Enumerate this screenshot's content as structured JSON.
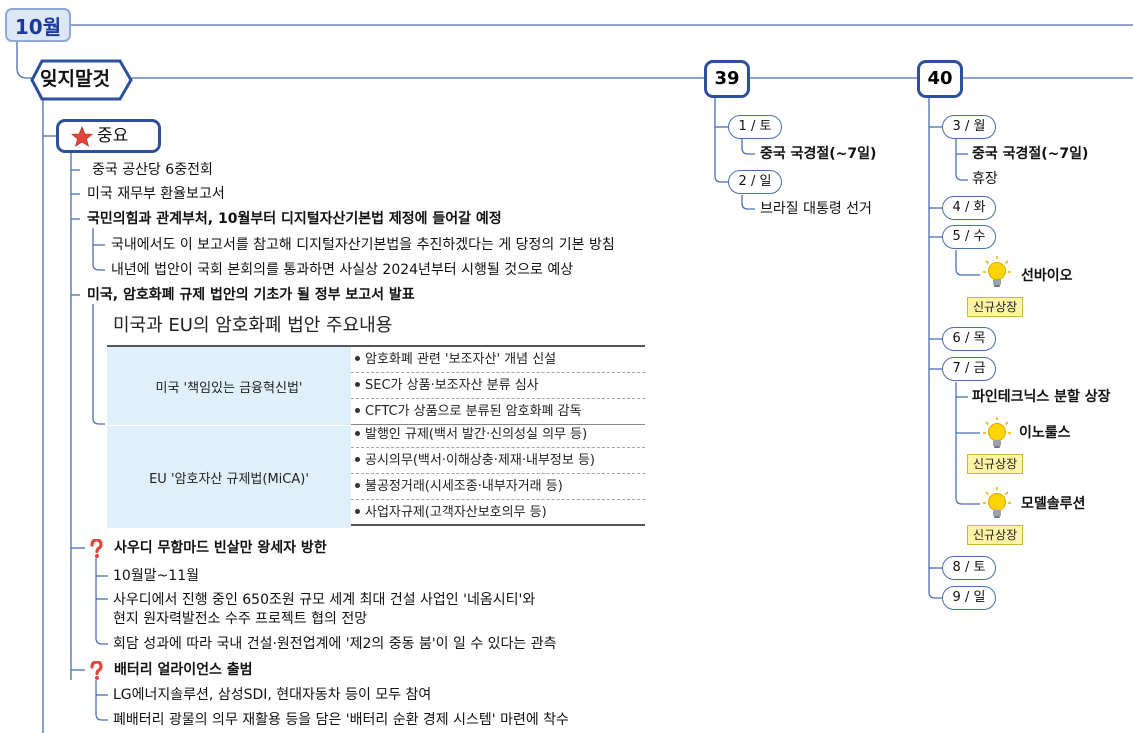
{
  "month": {
    "label": "10월"
  },
  "topic": {
    "label": "잊지말것"
  },
  "important": {
    "label": "중요"
  },
  "items": {
    "i1": "중국 공산당 6중전회",
    "i2": "미국 재무부 환율보고서",
    "i3": "국민의힘과 관계부처, 10월부터 디지털자산기본법 제정에 들어갈 예정",
    "i3a": "국내에서도 이 보고서를 참고해 디지털자산기본법을 추진하겠다는 게 당정의 기본 방침",
    "i3b": "내년에 법안이 국회 본회의를 통과하면 사실상 2024년부터 시행될 것으로 예상",
    "i4": "미국, 암호화폐 규제 법안의 기초가 될 정부 보고서 발표",
    "i5": "사우디 무함마드 빈살만 왕세자 방한",
    "i5a": "10월말~11월",
    "i5b1": "사우디에서 진행 중인 650조원 규모 세계 최대 건설 사업인 '네옴시티'와",
    "i5b2": "현지 원자력발전소 수주 프로젝트 협의 전망",
    "i5c": "회담 성과에 따라 국내 건설·원전업계에 '제2의 중동 붐'이 일 수 있다는 관측",
    "i6": "배터리 얼라이언스 출범",
    "i6a": "LG에너지솔루션, 삼성SDI, 현대자동차 등이 모두 참여",
    "i6b": "폐배터리 광물의 의무 재활용 등을 담은 '배터리 순환 경제 시스템' 마련에 착수"
  },
  "table": {
    "title": "미국과 EU의 암호화폐 법안 주요내용",
    "groups": [
      {
        "name": "미국 '책임있는 금융혁신법'",
        "rows": [
          "암호화폐 관련 '보조자산' 개념 신설",
          "SEC가 상품·보조자산 분류 심사",
          "CFTC가 상품으로 분류된 암호화폐 감독"
        ]
      },
      {
        "name": "EU '암호자산 규제법(MiCA)'",
        "rows": [
          "발행인 규제(백서 발간·신의성실 의무 등)",
          "공시의무(백서·이해상충·제재·내부정보 등)",
          "불공정거래(시세조종·내부자거래 등)",
          "사업자규제(고객자산보호의무 등)"
        ]
      }
    ]
  },
  "week39": {
    "label": "39",
    "d1": "1 / 토",
    "d1a": "중국 국경절(~7일)",
    "d2": "2 / 일",
    "d2a": "브라질 대통령 선거"
  },
  "week40": {
    "label": "40",
    "d3": "3 / 월",
    "d3a": "중국 국경절(~7일)",
    "d3b": "휴장",
    "d4": "4 / 화",
    "d5": "5 / 수",
    "d5a": "선바이오",
    "d6": "6 / 목",
    "d7": "7 / 금",
    "d7a": "파인테크닉스 분할 상장",
    "d7b": "이노룰스",
    "d7c": "모델솔루션",
    "d8": "8 / 토",
    "d9": "9 / 일"
  },
  "badge": "신규상장",
  "colors": {
    "line": "#4a6db5",
    "nodeBorder": "#2e4f9e",
    "monthFill": "#dde7f6",
    "badge": "#fff3a6",
    "tableFill": "#dff0fa"
  }
}
